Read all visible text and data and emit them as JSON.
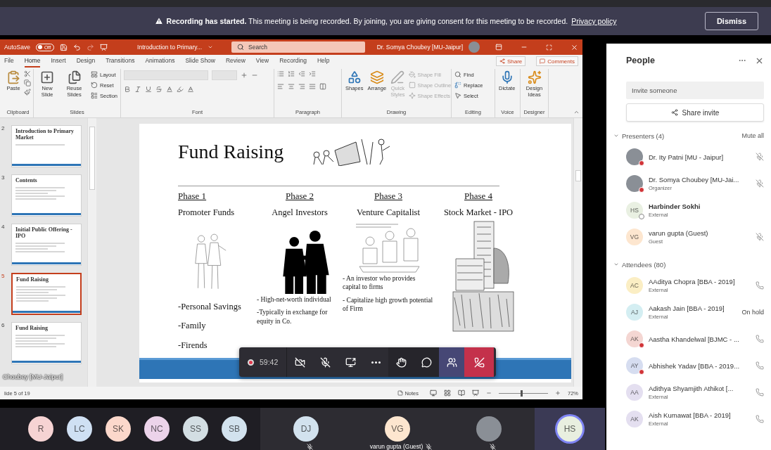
{
  "banner": {
    "message": "**Recording has started.** This meeting is being recorded. By joining, you are giving consent for this meeting to be recorded.",
    "link": "Privacy policy",
    "button": "Dismiss"
  },
  "powerpoint": {
    "title_bar": {
      "autosave": "AutoSave",
      "autosave_on": false,
      "toggle_label": "Off",
      "document": "Introduction to Primary...",
      "search_placeholder": "Search",
      "user": "Dr. Somya Choubey [MU-Jaipur]"
    },
    "tabs": [
      {
        "label": "File",
        "selected": false
      },
      {
        "label": "Home",
        "selected": true
      },
      {
        "label": "Insert",
        "selected": false
      },
      {
        "label": "Design",
        "selected": false
      },
      {
        "label": "Transitions",
        "selected": false
      },
      {
        "label": "Animations",
        "selected": false
      },
      {
        "label": "Slide Show",
        "selected": false
      },
      {
        "label": "Review",
        "selected": false
      },
      {
        "label": "View",
        "selected": false
      },
      {
        "label": "Recording",
        "selected": false
      },
      {
        "label": "Help",
        "selected": false
      }
    ],
    "share": "Share",
    "comments": "Comments",
    "ribbon": [
      {
        "kind": "clipboard",
        "label": "Clipboard",
        "items": [
          {
            "label": "Paste",
            "disabled": false
          }
        ]
      },
      {
        "kind": "slides",
        "label": "Slides",
        "items": [
          {
            "label": "New Slide",
            "disabled": false
          },
          {
            "label": "Reuse Slides",
            "disabled": false
          },
          {
            "label": "Layout",
            "disabled": false
          },
          {
            "label": "Reset",
            "disabled": false
          },
          {
            "label": "Section",
            "disabled": false
          }
        ]
      },
      {
        "kind": "font",
        "label": "Font"
      },
      {
        "kind": "paragraph",
        "label": "Paragraph"
      },
      {
        "kind": "drawing",
        "label": "Drawing",
        "items": [
          {
            "label": "Shapes",
            "disabled": false
          },
          {
            "label": "Arrange",
            "disabled": false
          },
          {
            "label": "Quick Styles",
            "disabled": true
          },
          {
            "label": "Shape Fill",
            "disabled": true
          },
          {
            "label": "Shape Outline",
            "disabled": true
          },
          {
            "label": "Shape Effects",
            "disabled": true
          }
        ]
      },
      {
        "kind": "editing",
        "label": "Editing",
        "items": [
          {
            "label": "Find",
            "disabled": false
          },
          {
            "label": "Replace",
            "disabled": false
          },
          {
            "label": "Select",
            "disabled": false
          }
        ]
      },
      {
        "kind": "voice",
        "label": "Voice",
        "items": [
          {
            "label": "Dictate",
            "disabled": false
          }
        ]
      },
      {
        "kind": "designer",
        "label": "Designer",
        "items": [
          {
            "label": "Design Ideas",
            "disabled": false
          }
        ]
      }
    ],
    "thumbnails": [
      {
        "number": "2",
        "title": "Introduction to Primary Market",
        "selected": false
      },
      {
        "number": "3",
        "title": "Contents",
        "selected": false
      },
      {
        "number": "4",
        "title": "Initial Public Offering - IPO",
        "selected": false
      },
      {
        "number": "5",
        "title": "Fund Raising",
        "selected": true
      },
      {
        "number": "6",
        "title": "Fund Raising",
        "selected": false
      }
    ],
    "slide": {
      "title": "Fund Raising",
      "phases": [
        {
          "kind": "large-list",
          "phase": "Phase 1",
          "title": "Promoter Funds",
          "picture": {
            "kind": "sketch-pair"
          },
          "bullets": [
            "-Personal Savings",
            "-Family",
            "-Firends"
          ]
        },
        {
          "kind": "small-list",
          "phase": "Phase 2",
          "title": "Angel Investors",
          "picture": {
            "kind": "silhouette"
          },
          "bullets": [
            "- High-net-worth individual",
            "-Typically in exchange for equity in Co."
          ]
        },
        {
          "kind": "small-list",
          "phase": "Phase 3",
          "title": "Venture Capitalist",
          "picture": {
            "kind": "sketch-meeting"
          },
          "bullets": [
            "- An investor who provides capital to firms",
            "- Capitalize high growth potential of Firm"
          ]
        },
        {
          "kind": "small-list",
          "phase": "Phase 4",
          "title": "Stock Market - IPO",
          "picture": {
            "kind": "building"
          }
        }
      ]
    },
    "status_bar": {
      "slide_count": "lide 5 of 19",
      "notes": "Notes",
      "zoom": "72%",
      "zoom_slider": {
        "level": 0.45
      }
    }
  },
  "video_label": "Choubey [MU-Jaipur]",
  "meeting_controls": {
    "timer": "59:42",
    "recording": true,
    "camera_on": false,
    "mic_on": false,
    "people_selected": true
  },
  "gallery": {
    "avatars": [
      {
        "initials": "R",
        "color": "#f6d3d3"
      },
      {
        "initials": "LC",
        "color": "#cfe0f3"
      },
      {
        "initials": "SK",
        "color": "#fcd8cb"
      },
      {
        "initials": "NC",
        "color": "#ecd3ea"
      },
      {
        "initials": "SS",
        "color": "#d3dee3"
      },
      {
        "initials": "SB",
        "color": "#d2e2ee"
      }
    ],
    "tiles": [
      {
        "kind": "initials",
        "initials": "DJ",
        "color": "#d2e2ee",
        "muted": true,
        "speaking": false
      },
      {
        "kind": "initials",
        "initials": "VG",
        "color": "#fde6cf",
        "name": "varun gupta (Guest)",
        "muted": true,
        "speaking": false
      },
      {
        "kind": "photo",
        "muted": true,
        "speaking": false
      },
      {
        "kind": "initials",
        "initials": "HS",
        "color": "#e8efe0",
        "muted": false,
        "speaking": true
      }
    ]
  },
  "people_panel": {
    "title": "People",
    "invite_placeholder": "Invite someone",
    "share_button": "Share invite",
    "sections": [
      {
        "title": "Presenters (4)",
        "expanded": true,
        "action": "Mute all",
        "members": [
          {
            "kind": "photo",
            "name": "Dr. Ity Patni [MU - Jaipur]",
            "badge": {
              "kind": "alert"
            },
            "emphasized": false,
            "trailing": {
              "kind": "mic-off"
            }
          },
          {
            "kind": "photo",
            "name": "Dr. Somya Choubey [MU-Jai...",
            "role": "Organizer",
            "badge": {
              "kind": "alert"
            },
            "emphasized": false,
            "trailing": {
              "kind": "mic-off"
            }
          },
          {
            "kind": "initials",
            "name": "Harbinder Sokhi",
            "role": "External",
            "initials": "HS",
            "color": "#e9f0e2",
            "badge": {
              "kind": "idle"
            },
            "emphasized": true
          },
          {
            "kind": "initials",
            "name": "varun gupta (Guest)",
            "role": "Guest",
            "initials": "VG",
            "color": "#fde6cf",
            "emphasized": false,
            "trailing": {
              "kind": "mic-off"
            }
          }
        ]
      },
      {
        "title": "Attendees (80)",
        "expanded": true,
        "members": [
          {
            "kind": "initials",
            "name": "AAditya Chopra [BBA - 2019]",
            "role": "External",
            "initials": "AC",
            "color": "#fbeec4",
            "emphasized": false,
            "trailing": {
              "kind": "phone"
            }
          },
          {
            "kind": "initials",
            "name": "Aakash Jain [BBA - 2019]",
            "role": "External",
            "initials": "AJ",
            "color": "#d4eef2",
            "emphasized": false,
            "trailing": {
              "kind": "text",
              "text": "On hold"
            }
          },
          {
            "kind": "initials",
            "name": "Aastha Khandelwal [BJMC - ...",
            "initials": "AK",
            "color": "#f4d6d2",
            "badge": {
              "kind": "alert"
            },
            "emphasized": false,
            "trailing": {
              "kind": "phone"
            }
          },
          {
            "kind": "initials",
            "name": "Abhishek Yadav [BBA - 2019...",
            "initials": "AY",
            "color": "#d6ddf0",
            "badge": {
              "kind": "alert"
            },
            "emphasized": false,
            "trailing": {
              "kind": "phone"
            }
          },
          {
            "kind": "initials",
            "name": "Adithya Shyamjith Athikot [...",
            "role": "External",
            "initials": "AA",
            "color": "#e4dff0",
            "emphasized": false,
            "trailing": {
              "kind": "phone"
            }
          },
          {
            "kind": "initials",
            "name": "Aish Kumawat [BBA - 2019]",
            "role": "External",
            "initials": "AK",
            "color": "#e4dff0",
            "emphasized": false,
            "trailing": {
              "kind": "phone"
            }
          }
        ]
      }
    ]
  }
}
